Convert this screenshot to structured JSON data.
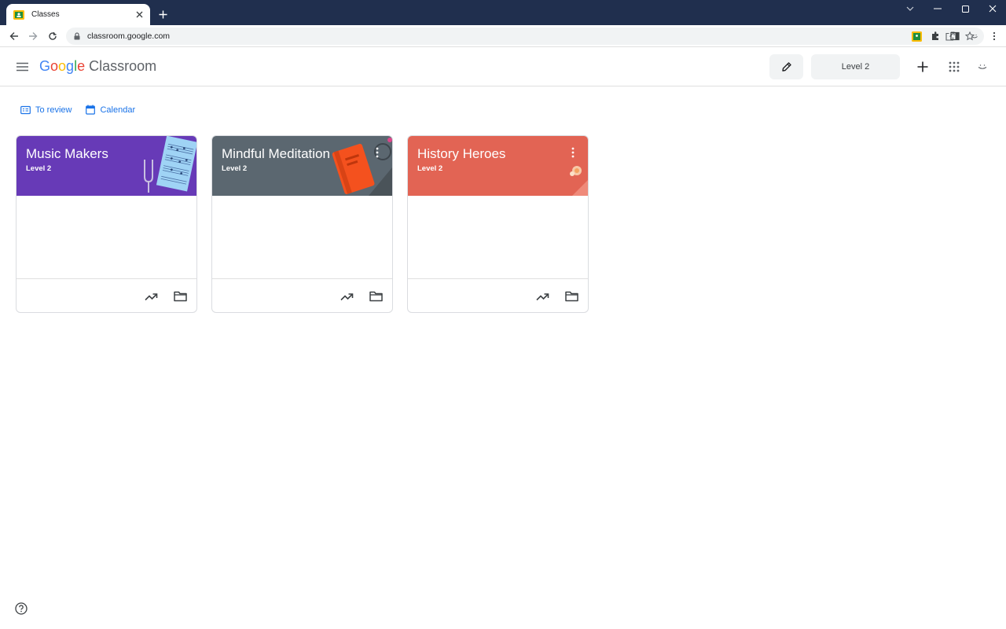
{
  "browser": {
    "tab_title": "Classes",
    "url": "classroom.google.com"
  },
  "header": {
    "logo_google": [
      "G",
      "o",
      "o",
      "g",
      "l",
      "e"
    ],
    "logo_product": "Classroom",
    "level_button": "Level 2"
  },
  "subnav": {
    "to_review": "To review",
    "calendar": "Calendar"
  },
  "classes": [
    {
      "title": "Music Makers",
      "subtitle": "Level 2",
      "color": "#673ab7"
    },
    {
      "title": "Mindful Meditation",
      "subtitle": "Level 2",
      "color": "#5b6770"
    },
    {
      "title": "History Heroes",
      "subtitle": "Level 2",
      "color": "#e26454"
    }
  ]
}
